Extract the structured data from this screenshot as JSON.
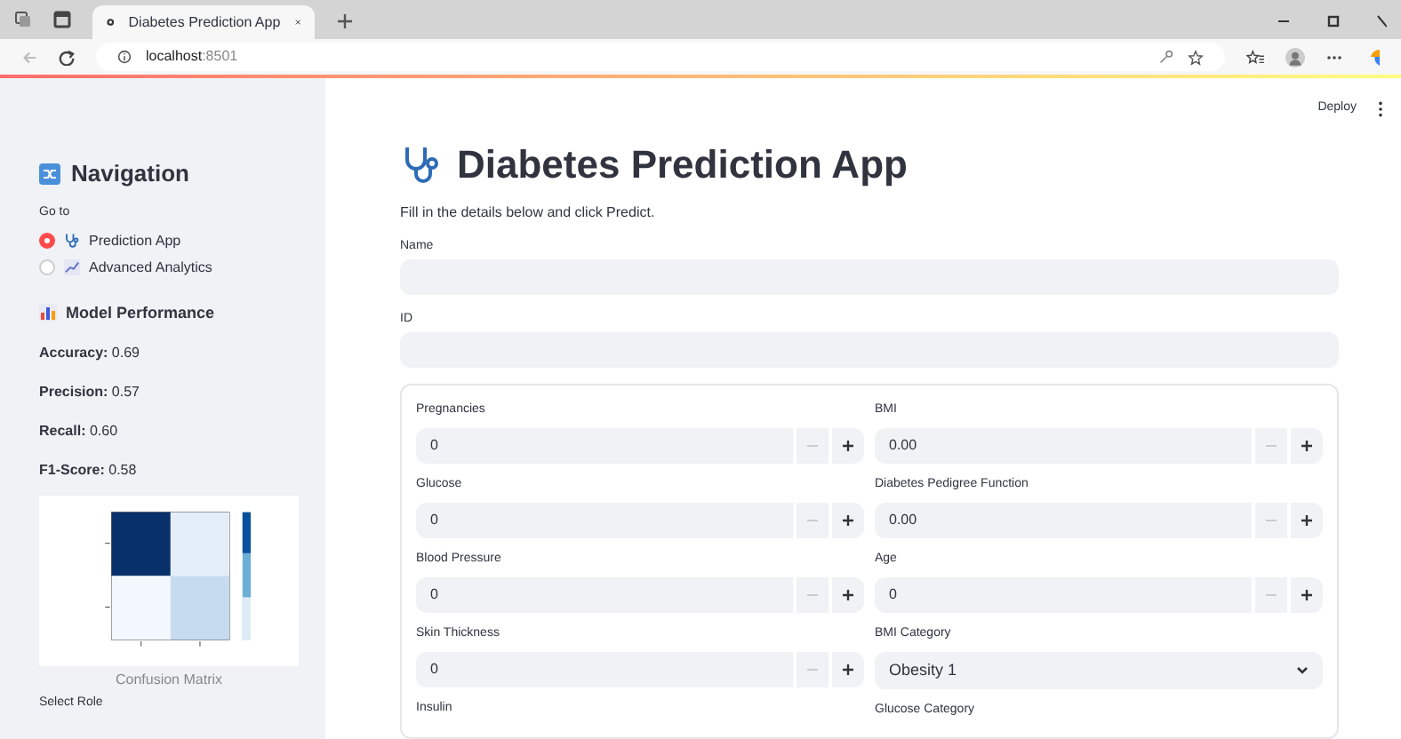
{
  "browser": {
    "tab_title": "Diabetes Prediction App",
    "url_host": "localhost",
    "url_port": ":8501"
  },
  "sidebar": {
    "title": "Navigation",
    "goto_label": "Go to",
    "options": [
      {
        "label": "Prediction App",
        "selected": true
      },
      {
        "label": "Advanced Analytics",
        "selected": false
      }
    ],
    "performance_title": "Model Performance",
    "metrics": [
      {
        "name": "Accuracy:",
        "value": "0.69"
      },
      {
        "name": "Precision:",
        "value": "0.57"
      },
      {
        "name": "Recall:",
        "value": "0.60"
      },
      {
        "name": "F1-Score:",
        "value": "0.58"
      }
    ],
    "image_caption": "Confusion Matrix",
    "next_label": "Select Role"
  },
  "header": {
    "deploy": "Deploy"
  },
  "main": {
    "title": "Diabetes Prediction App",
    "subtitle": "Fill in the details below and click Predict.",
    "text_fields": [
      {
        "label": "Name"
      },
      {
        "label": "ID"
      }
    ],
    "columns": [
      [
        {
          "label": "Pregnancies",
          "kind": "number",
          "value": "0"
        },
        {
          "label": "Glucose",
          "kind": "number",
          "value": "0"
        },
        {
          "label": "Blood Pressure",
          "kind": "number",
          "value": "0"
        },
        {
          "label": "Skin Thickness",
          "kind": "number",
          "value": "0"
        },
        {
          "label": "Insulin",
          "kind": "label"
        }
      ],
      [
        {
          "label": "BMI",
          "kind": "number",
          "value": "0.00"
        },
        {
          "label": "Diabetes Pedigree Function",
          "kind": "number",
          "value": "0.00"
        },
        {
          "label": "Age",
          "kind": "number",
          "value": "0"
        },
        {
          "label": "BMI Category",
          "kind": "select",
          "value": "Obesity 1"
        },
        {
          "label": "Glucose Category",
          "kind": "label"
        }
      ]
    ]
  }
}
